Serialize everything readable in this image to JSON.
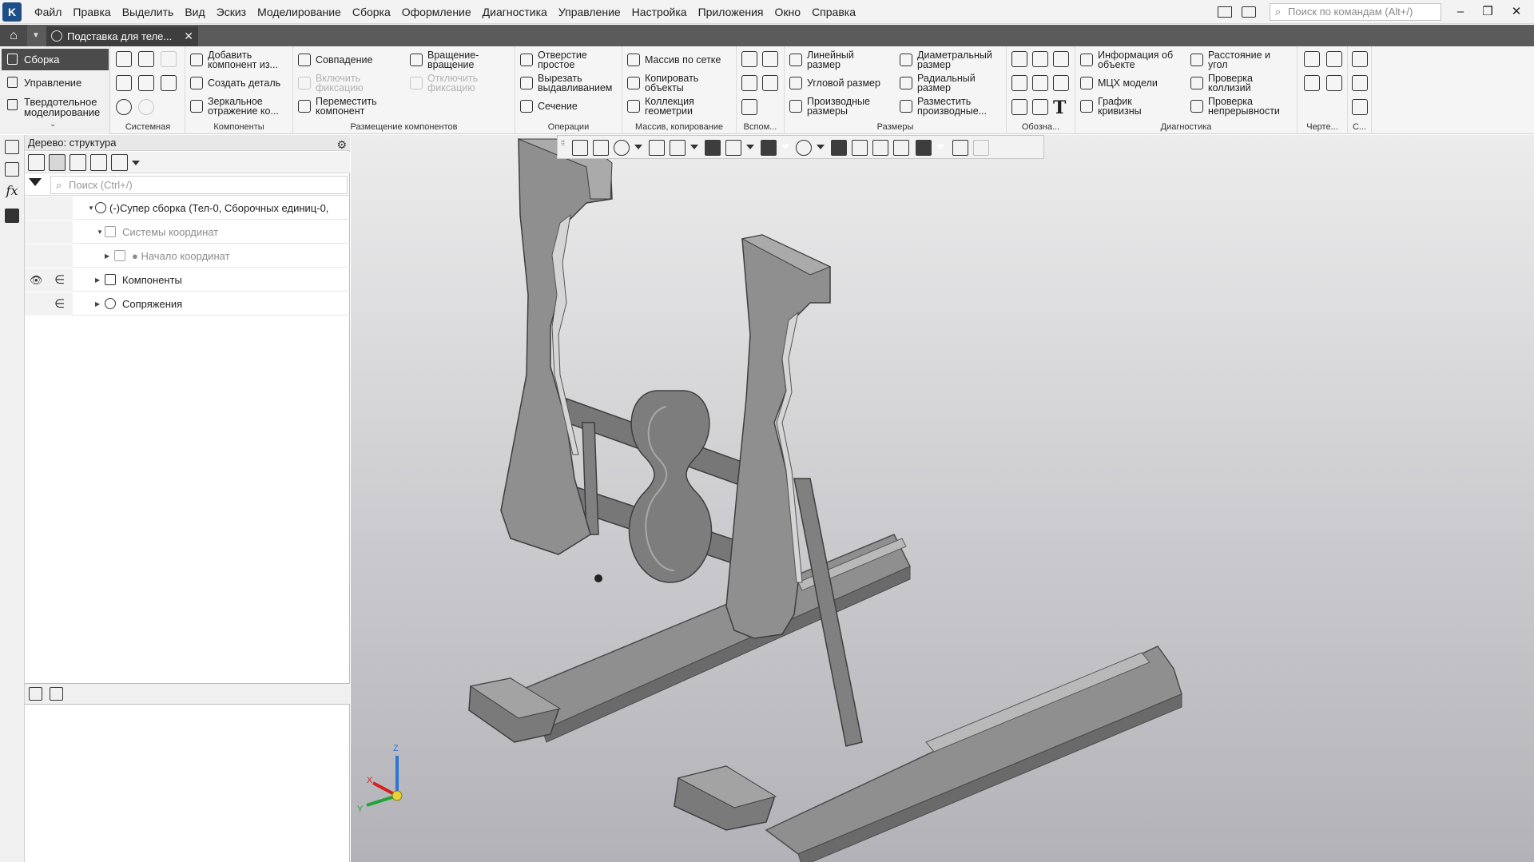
{
  "menubar": {
    "items": [
      "Файл",
      "Правка",
      "Выделить",
      "Вид",
      "Эскиз",
      "Моделирование",
      "Сборка",
      "Оформление",
      "Диагностика",
      "Управление",
      "Настройка",
      "Приложения",
      "Окно",
      "Справка"
    ],
    "search_placeholder": "Поиск по командам (Alt+/)"
  },
  "tabs": {
    "document": "Подставка для теле..."
  },
  "modes": {
    "items": [
      {
        "label": "Сборка",
        "active": true
      },
      {
        "label": "Управление",
        "active": false
      },
      {
        "label": "Твердотельное моделирование",
        "active": false
      }
    ]
  },
  "ribbon": {
    "groups": {
      "system": "Системная",
      "components": "Компоненты",
      "placement": "Размещение компонентов",
      "operations": "Операции",
      "array": "Массив, копирование",
      "aux": "Вспом...",
      "dimensions": "Размеры",
      "notation": "Обозна...",
      "diagnostics": "Диагностика",
      "drawing": "Черте...",
      "c": "С..."
    },
    "buttons": {
      "add_component": "Добавить компонент из...",
      "create_part": "Создать деталь",
      "mirror": "Зеркальное отражение ко...",
      "coincidence": "Совпадение",
      "enable_fix": "Включить фиксацию",
      "move_component": "Переместить компонент",
      "rotation": "Вращение-вращение",
      "disable_fix": "Отключить фиксацию",
      "simple_hole": "Отверстие простое",
      "cut_extrude": "Вырезать выдавливанием",
      "section": "Сечение",
      "grid_array": "Массив по сетке",
      "copy_objects": "Копировать объекты",
      "geometry_collection": "Коллекция геометрии",
      "linear_dim": "Линейный размер",
      "angular_dim": "Угловой размер",
      "derived_dims": "Производные размеры",
      "diameter_dim": "Диаметральный размер",
      "radial_dim": "Радиальный размер",
      "place_derived": "Разместить производные...",
      "object_info": "Информация об объекте",
      "mcx_model": "МЦХ модели",
      "curvature_graph": "График кривизны",
      "distance_angle": "Расстояние и угол",
      "collision_check": "Проверка коллизий",
      "continuity_check": "Проверка непрерывности"
    }
  },
  "tree": {
    "header": "Дерево: структура",
    "search_placeholder": "Поиск (Ctrl+/)",
    "rows": [
      {
        "label": "(-)Супер сборка (Тел-0, Сборочных единиц-0,"
      },
      {
        "label": "Системы координат"
      },
      {
        "label": "● Начало координат"
      },
      {
        "label": "Компоненты"
      },
      {
        "label": "Сопряжения"
      }
    ],
    "glyphs": {
      "eye": "👁",
      "include": "∈"
    }
  },
  "axes": {
    "x": "X",
    "y": "Y",
    "z": "Z"
  },
  "colors": {
    "accent_dark": "#4b4b4b",
    "model_fill": "#8f8f8f",
    "model_dark": "#6a6a6a",
    "model_light": "#b9b9b9",
    "axis_x": "#d62020",
    "axis_y": "#1fa33a",
    "axis_z": "#2f74d0"
  }
}
